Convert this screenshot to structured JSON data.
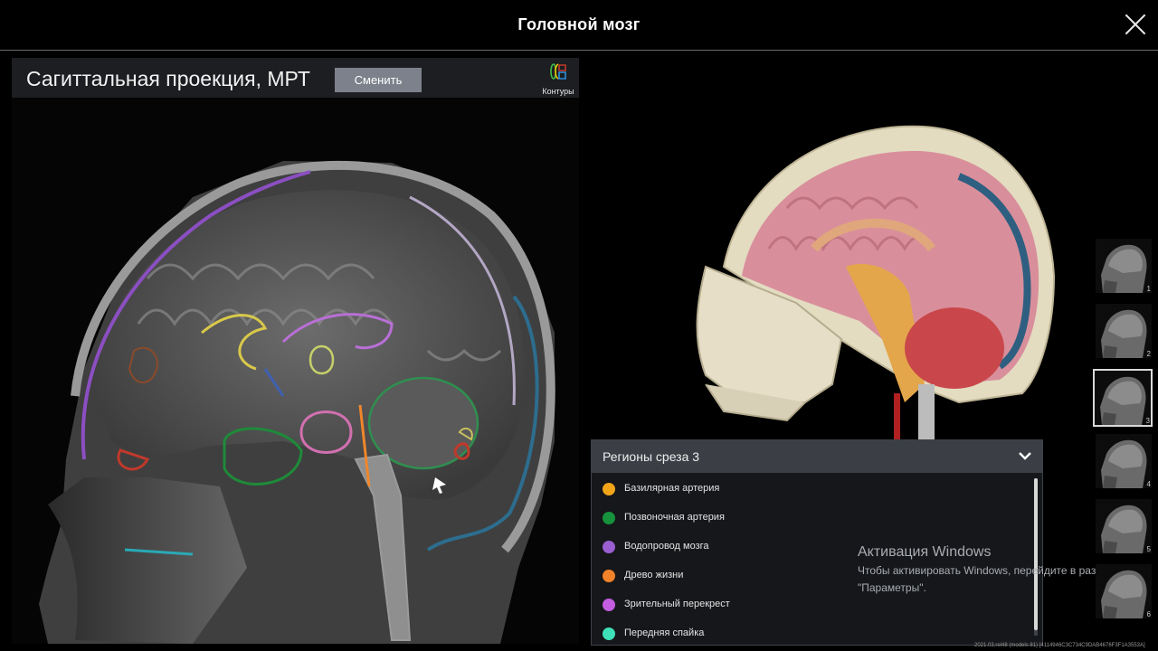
{
  "app": {
    "title": "Головной мозг"
  },
  "mri": {
    "view_title": "Сагиттальная проекция, МРТ",
    "change_label": "Сменить",
    "contours_label": "Контуры"
  },
  "regions": {
    "title": "Регионы среза 3",
    "items": [
      {
        "label": "Базилярная артерия",
        "color": "#f3a51a"
      },
      {
        "label": "Позвоночная артерия",
        "color": "#16923c"
      },
      {
        "label": "Водопровод мозга",
        "color": "#9a5fd0"
      },
      {
        "label": "Древо жизни",
        "color": "#f0822a"
      },
      {
        "label": "Зрительный перекрест",
        "color": "#c35ee0"
      },
      {
        "label": "Передняя спайка",
        "color": "#3ee0b8"
      }
    ]
  },
  "activation": {
    "title": "Активация Windows",
    "line1": "Чтобы активировать Windows, перейдите в раздел",
    "line2": "\"Параметры\"."
  },
  "build_info": "2021.03.rel48 (models 81) [4114946C3C734C9DAB4676F3F1A3553A]",
  "slices": {
    "items": [
      "1",
      "2",
      "3",
      "4",
      "5",
      "6"
    ],
    "selected_index": 2
  }
}
